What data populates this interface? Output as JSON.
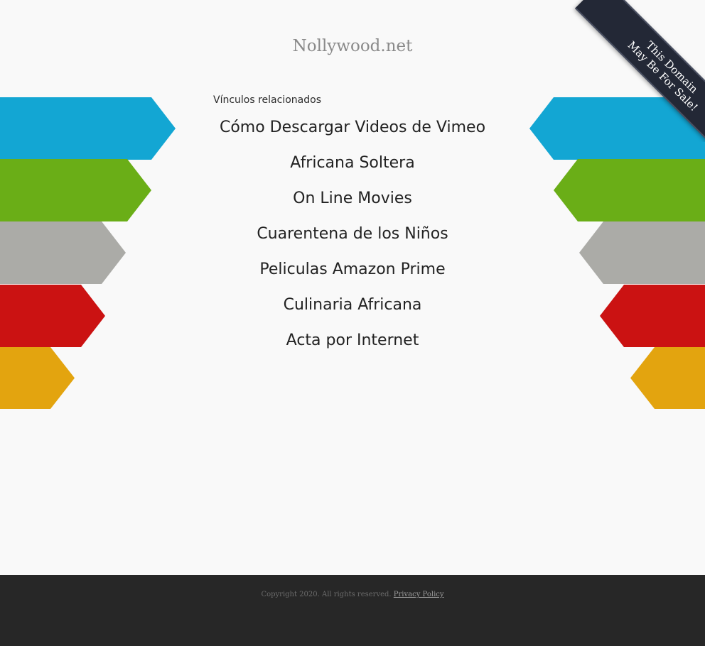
{
  "domain_title": "Nollywood.net",
  "related_label": "Vínculos relacionados",
  "links": [
    "Cómo Descargar Videos de Vimeo",
    "Africana Soltera",
    "On Line Movies",
    "Cuarentena de los Niños",
    "Peliculas Amazon Prime",
    "Culinaria Africana",
    "Acta por Internet"
  ],
  "ribbon": {
    "line1": "This Domain",
    "line2": "May Be For Sale!"
  },
  "footer": {
    "copyright": "Copyright 2020. All rights reserved.",
    "privacy": "Privacy Policy"
  },
  "colors": {
    "arrow_blue": "#13a6d3",
    "arrow_green": "#6aae17",
    "arrow_gray": "#ababa7",
    "arrow_red": "#cb1212",
    "arrow_yellow": "#e3a40f",
    "footer_bg": "#272727",
    "ribbon_bg": "#232836"
  }
}
